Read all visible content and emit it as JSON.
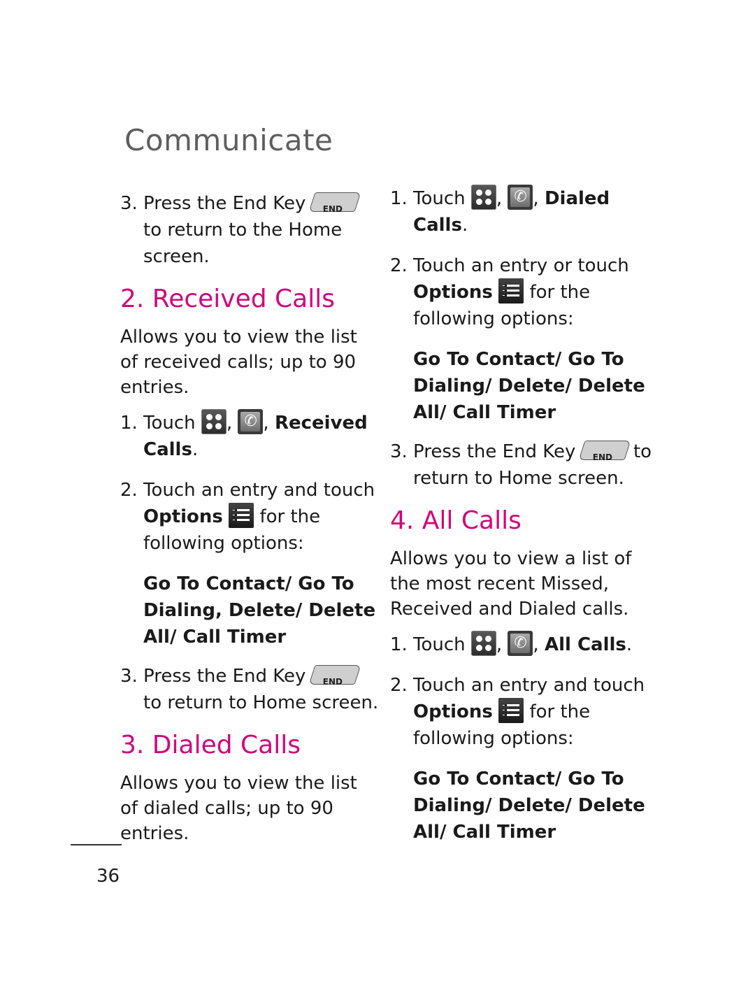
{
  "page": {
    "title": "Communicate",
    "number": "36"
  },
  "colors": {
    "heading": "#d0067c",
    "title": "#5e5e5e"
  },
  "icons": {
    "end_key_label": "END"
  },
  "left": {
    "step3_top": {
      "num": "3.",
      "pre": "Press the End Key",
      "post": "to return to the Home screen."
    },
    "received": {
      "heading": "2. Received Calls",
      "desc": "Allows you to view the list of received calls; up to 90 entries.",
      "step1": {
        "num": "1.",
        "pre": "Touch",
        "sep": ",",
        "sep2": ",",
        "bold": "Received Calls",
        "end": "."
      },
      "step2": {
        "num": "2.",
        "pre": "Touch an entry and touch",
        "bold": "Options",
        "post": "for the following options:"
      },
      "options": "Go To Contact/ Go To Dialing, Delete/ Delete All/ Call Timer",
      "step3": {
        "num": "3.",
        "pre": "Press the End Key",
        "post": "to return to Home screen."
      }
    },
    "dialed": {
      "heading": "3. Dialed Calls",
      "desc": "Allows you to view the list of dialed calls; up to 90 entries."
    }
  },
  "right": {
    "dialed": {
      "step1": {
        "num": "1.",
        "pre": "Touch",
        "sep": ",",
        "sep2": ",",
        "bold": "Dialed Calls",
        "end": "."
      },
      "step2": {
        "num": "2.",
        "pre": "Touch an entry or touch",
        "bold": "Options",
        "post": "for the following options:"
      },
      "options": "Go To Contact/ Go To Dialing/ Delete/ Delete All/ Call Timer",
      "step3": {
        "num": "3.",
        "pre": "Press the End Key",
        "post": "to return to Home screen."
      }
    },
    "all": {
      "heading": "4. All Calls",
      "desc": "Allows you to view a list of the most recent Missed, Received and Dialed calls.",
      "step1": {
        "num": "1.",
        "pre": "Touch",
        "sep": ",",
        "sep2": ",",
        "bold": "All Calls",
        "end": "."
      },
      "step2": {
        "num": "2.",
        "pre": "Touch an entry and touch",
        "bold": "Options",
        "post": "for the following options:"
      },
      "options": "Go To Contact/ Go To Dialing/ Delete/ Delete All/ Call Timer"
    }
  }
}
